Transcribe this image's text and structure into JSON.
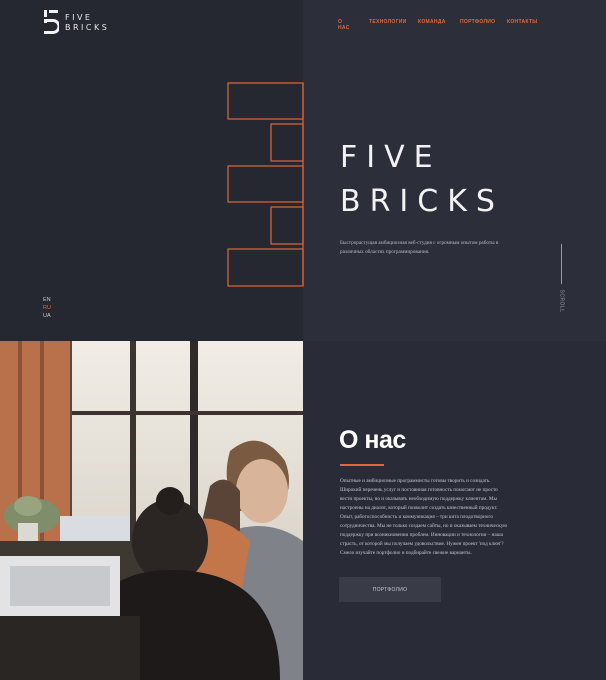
{
  "brand": {
    "line1": "FIVE",
    "line2": "BRICKS",
    "accent_color": "#e0683a"
  },
  "nav": {
    "items": [
      {
        "label": "О НАС"
      },
      {
        "label": "ТЕХНОЛОГИИ"
      },
      {
        "label": "КОМАНДА"
      },
      {
        "label": "ПОРТФОЛИО"
      },
      {
        "label": "КОНТАКТЫ"
      }
    ]
  },
  "hero": {
    "title_line1": "FIVE",
    "title_line2": "BRICKS",
    "description": "Быстрорастущая амбициозная веб-студия с огромным опытом работы в различных областях программирования.",
    "scroll_label": "SCROLL"
  },
  "languages": {
    "en": "EN",
    "ru": "RU",
    "ua": "UA",
    "active": "RU"
  },
  "about": {
    "title": "О нас",
    "text": "Опытные и амбициозные программисты готовы творить и созидать. Широкий перечень услуг и постоянная готовность помогают не просто вести проекты, но и оказывать необходимую поддержку клиентам. Мы настроены на диалог, который позволит создать качественный продукт. Опыт, работоспособность и коммуникация – три кита плодотворного сотрудничества. Мы не только создаем сайты, но и оказываем техническую поддержку при возникновении проблем. Инновации и технологии – наша страсть, от которой мы получаем удовольствие. Нужен проект 'под ключ'? Смело изучайте портфолио и подбирайте свежие варианты.",
    "button_label": "ПОРТФОЛИО"
  },
  "icons": [
    "five-bricks-logo-icon",
    "scroll-line-icon"
  ]
}
